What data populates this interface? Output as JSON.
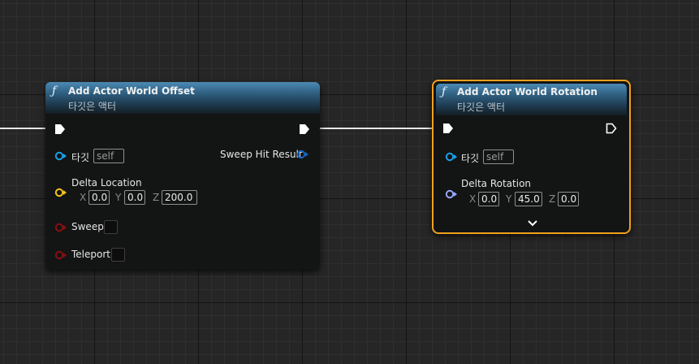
{
  "nodes": {
    "offset": {
      "title": "Add Actor World Offset",
      "subtitle": "타깃은 액터",
      "target_label": "타깃",
      "target_value": "self",
      "return_label": "Sweep Hit Result",
      "delta_label": "Delta Location",
      "x_label": "X",
      "x_value": "0.0",
      "y_label": "Y",
      "y_value": "0.0",
      "z_label": "Z",
      "z_value": "200.0",
      "sweep_label": "Sweep",
      "teleport_label": "Teleport"
    },
    "rotation": {
      "title": "Add Actor World Rotation",
      "subtitle": "타깃은 액터",
      "target_label": "타깃",
      "target_value": "self",
      "delta_label": "Delta Rotation",
      "x_label": "X",
      "x_value": "0.0",
      "y_label": "Y",
      "y_value": "45.0",
      "z_label": "Z",
      "z_value": "0.0"
    }
  },
  "icons": {
    "function": "function-icon",
    "exec": "exec-pin-icon",
    "object_pin": "object-pin-icon",
    "vector_pin": "vector-pin-icon",
    "rotator_pin": "rotator-pin-icon",
    "bool_pin": "bool-pin-icon",
    "struct_pin": "struct-pin-icon",
    "expand": "chevron-down-icon"
  },
  "colors": {
    "background": "#262626",
    "node_body": "#131414",
    "header_blue": "#3a6f94",
    "selection": "#f0a01e",
    "object_pin": "#1aa0e8",
    "vector_pin": "#f5c518",
    "rotator_pin": "#9aa6ff",
    "bool_pin": "#8a0f0f",
    "struct_pin": "#1565c0",
    "exec": "#ffffff"
  }
}
